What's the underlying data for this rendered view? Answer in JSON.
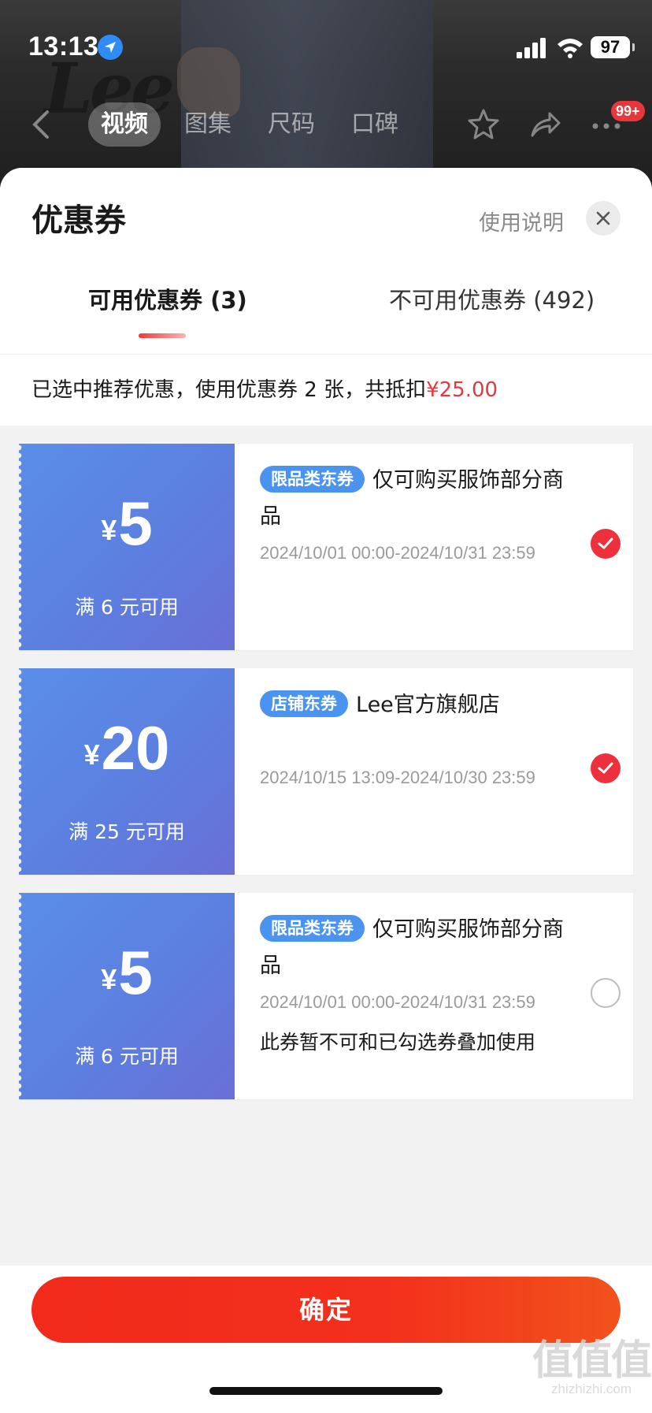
{
  "status_bar": {
    "time": "13:13",
    "battery": "97"
  },
  "background_page": {
    "brand": "Lee",
    "media_tabs": [
      "视频",
      "图集",
      "尺码",
      "口碑"
    ],
    "active_media_tab": 0,
    "cart_badge": "99+"
  },
  "sheet": {
    "title": "优惠券",
    "help_label": "使用说明",
    "tabs": [
      {
        "label": "可用优惠券 (3)",
        "active": true
      },
      {
        "label": "不可用优惠券 (492)",
        "active": false
      }
    ],
    "summary_text": "已选中推荐优惠，使用优惠券 2 张，共抵扣",
    "summary_amount": "¥25.00"
  },
  "coupons": [
    {
      "currency": "¥",
      "value": "5",
      "condition": "满 6 元可用",
      "tag": "限品类东券",
      "description": "仅可购买服饰部分商品",
      "validity": "2024/10/01 00:00-2024/10/31 23:59",
      "note": "",
      "selected": true
    },
    {
      "currency": "¥",
      "value": "20",
      "condition": "满 25 元可用",
      "tag": "店铺东券",
      "description": "Lee官方旗舰店",
      "validity": "2024/10/15 13:09-2024/10/30 23:59",
      "note": "",
      "selected": true
    },
    {
      "currency": "¥",
      "value": "5",
      "condition": "满 6 元可用",
      "tag": "限品类东券",
      "description": "仅可购买服饰部分商品",
      "validity": "2024/10/01 00:00-2024/10/31 23:59",
      "note": "此券暂不可和已勾选券叠加使用",
      "selected": false
    }
  ],
  "footer": {
    "confirm_label": "确定"
  },
  "watermark": {
    "logo": "值值值",
    "text": "zhizhizhi.com"
  },
  "colors": {
    "accent_red": "#e4393c",
    "coupon_blue": "#5c7fe0",
    "tag_blue": "#4a94f0"
  }
}
